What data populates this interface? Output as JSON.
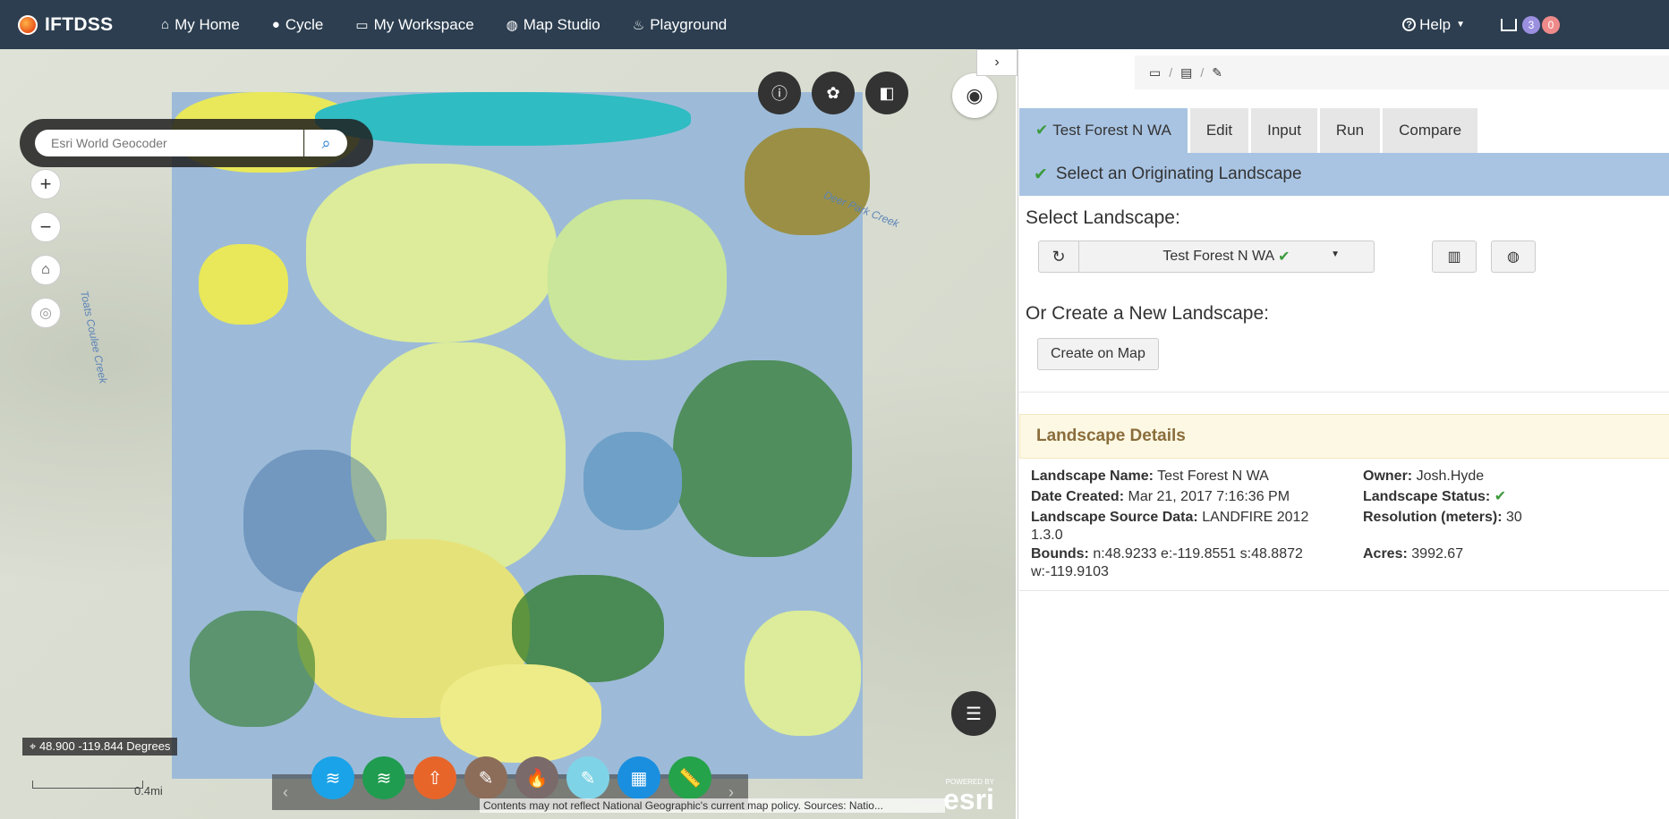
{
  "nav": {
    "brand": "IFTDSS",
    "items": [
      {
        "label": "My Home",
        "icon": "home-icon"
      },
      {
        "label": "Cycle",
        "icon": "cycle-icon"
      },
      {
        "label": "My Workspace",
        "icon": "window-icon"
      },
      {
        "label": "Map Studio",
        "icon": "globe-icon"
      },
      {
        "label": "Playground",
        "icon": "flame-icon"
      }
    ],
    "help": "Help",
    "badge_a": "3",
    "badge_b": "0"
  },
  "map": {
    "search_placeholder": "Esri World Geocoder",
    "creek_labels": [
      "Toats Coulee Creek",
      "Deer Park Creek"
    ],
    "coordinates": "48.900 -119.844 Degrees",
    "scale": "0.4mi",
    "attribution": "Contents may not reflect National Geographic's current map policy. Sources: Natio...",
    "esri_powered": "POWERED BY",
    "esri": "esri",
    "tool_colors": [
      "#1aa3e8",
      "#1f9c4f",
      "#e8652a",
      "#8c6d5a",
      "#7a6a6a",
      "#7fd3e6",
      "#1a8fe0",
      "#25a34a"
    ]
  },
  "panel": {
    "tabs": [
      "Test Forest N WA",
      "Edit",
      "Input",
      "Run",
      "Compare"
    ],
    "step_title": "Select an Originating Landscape",
    "select_label": "Select Landscape:",
    "selected_landscape": "Test Forest N WA",
    "create_label": "Or Create a New Landscape:",
    "create_button": "Create on Map",
    "details_title": "Landscape Details",
    "details": {
      "name_label": "Landscape Name:",
      "name": "Test Forest N WA",
      "created_label": "Date Created:",
      "created": "Mar 21, 2017 7:16:36 PM",
      "source_label": "Landscape Source Data:",
      "source_1": "LANDFIRE 2012",
      "source_2": "1.3.0",
      "bounds_label": "Bounds:",
      "bounds_1": "n:48.9233 e:-119.8551 s:48.8872",
      "bounds_2": "w:-119.9103",
      "owner_label": "Owner:",
      "owner": "Josh.Hyde",
      "status_label": "Landscape Status:",
      "resolution_label": "Resolution (meters):",
      "resolution": "30",
      "acres_label": "Acres:",
      "acres": "3992.67"
    }
  }
}
